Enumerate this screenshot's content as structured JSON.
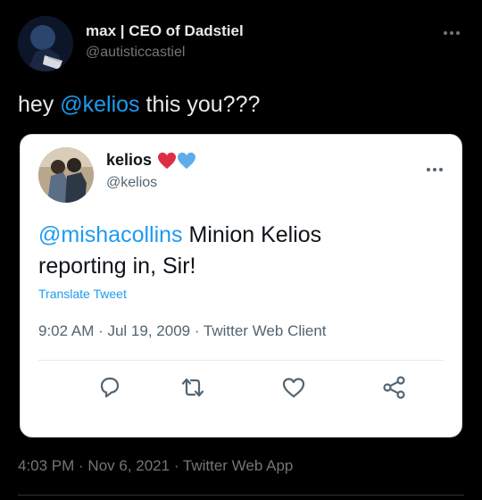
{
  "outer_tweet": {
    "display_name": "max | CEO of Dadstiel",
    "handle": "@autisticcastiel",
    "text_prefix": "hey ",
    "text_mention": "@kelios",
    "text_suffix": " this you???",
    "meta": "4:03 PM · Nov 6, 2021 · Twitter Web App"
  },
  "quoted_tweet": {
    "display_name": "kelios",
    "handle": "@kelios",
    "emoji": [
      "red-heart",
      "blue-heart"
    ],
    "text_mention": "@mishacollins",
    "text_line1_rest": " Minion Kelios",
    "text_line2": "reporting in, Sir!",
    "translate_label": "Translate Tweet",
    "meta": "9:02 AM · Jul 19, 2009 · Twitter Web Client",
    "actions": [
      "reply-icon",
      "retweet-icon",
      "like-icon",
      "share-icon"
    ]
  },
  "colors": {
    "background": "#000000",
    "card": "#ffffff",
    "link": "#1d9bf0",
    "muted_dark": "#71767b",
    "muted_light": "#536471"
  }
}
